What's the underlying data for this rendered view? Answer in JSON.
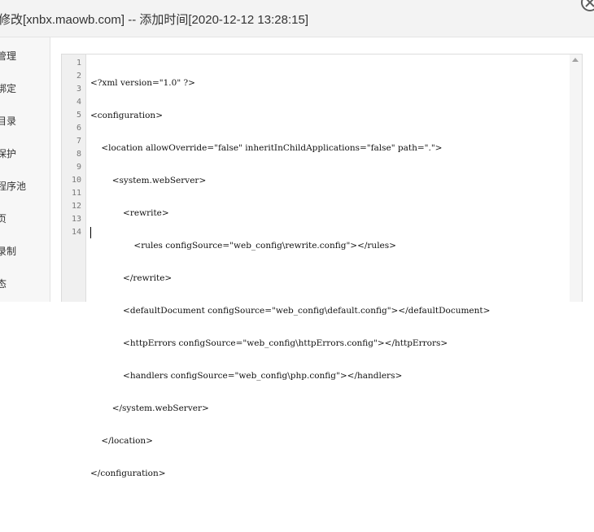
{
  "dialog": {
    "title": "修改[xnbx.maowb.com] -- 添加时间[2020-12-12 13:28:15]"
  },
  "sidebar": {
    "items": [
      {
        "label": "管理"
      },
      {
        "label": "绑定"
      },
      {
        "label": "目录"
      },
      {
        "label": "保护"
      },
      {
        "label": "程序池"
      },
      {
        "label": "页"
      },
      {
        "label": "录制"
      },
      {
        "label": "态"
      }
    ]
  },
  "editor": {
    "line_numbers": [
      "1",
      "2",
      "3",
      "4",
      "5",
      "6",
      "7",
      "8",
      "9",
      "10",
      "11",
      "12",
      "13",
      "14"
    ],
    "lines": [
      "<?xml version=\"1.0\" ?>",
      "<configuration>",
      "    <location allowOverride=\"false\" inheritInChildApplications=\"false\" path=\".\">",
      "        <system.webServer>",
      "            <rewrite>",
      "                <rules configSource=\"web_config\\rewrite.config\"></rules>",
      "            </rewrite>",
      "            <defaultDocument configSource=\"web_config\\default.config\"></defaultDocument>",
      "            <httpErrors configSource=\"web_config\\httpErrors.config\"></httpErrors>",
      "            <handlers configSource=\"web_config\\php.config\"></handlers>",
      "        </system.webServer>",
      "    </location>",
      "</configuration>",
      ""
    ]
  }
}
